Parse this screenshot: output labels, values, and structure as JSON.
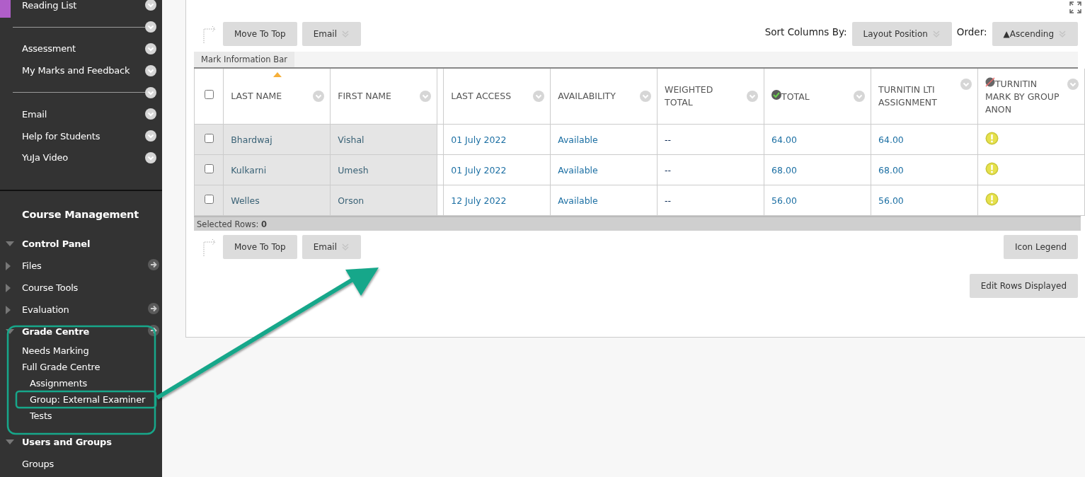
{
  "sidebar": {
    "course_menu": [
      {
        "kind": "link",
        "label": "Reading List"
      },
      {
        "kind": "divider"
      },
      {
        "kind": "link",
        "label": "Assessment"
      },
      {
        "kind": "link",
        "label": "My Marks and Feedback"
      },
      {
        "kind": "divider"
      },
      {
        "kind": "link",
        "label": "Email"
      },
      {
        "kind": "link",
        "label": "Help for Students"
      },
      {
        "kind": "link",
        "label": "YuJa Video"
      }
    ],
    "management": {
      "title": "Course Management",
      "sections": [
        {
          "label": "Control Panel",
          "expanded": true,
          "children": [
            {
              "label": "Files",
              "expanded": false,
              "go_icon": true
            },
            {
              "label": "Course Tools",
              "expanded": false,
              "go_icon": false
            },
            {
              "label": "Evaluation",
              "expanded": false,
              "go_icon": true
            },
            {
              "label": "Grade Centre",
              "expanded": true,
              "go_icon": true,
              "children": [
                {
                  "label": "Needs Marking"
                },
                {
                  "label": "Full Grade Centre",
                  "children": [
                    {
                      "label": "Assignments"
                    },
                    {
                      "label": "Group: External Examiner"
                    },
                    {
                      "label": "Tests"
                    }
                  ]
                }
              ]
            }
          ]
        },
        {
          "label": "Users and Groups",
          "expanded": true,
          "children": [
            {
              "label": "Groups"
            }
          ]
        }
      ]
    }
  },
  "grade_centre": {
    "top_actions": [
      {
        "label": "Move To Top",
        "menu": false
      },
      {
        "label": "Email",
        "menu": true
      }
    ],
    "sort_columns": {
      "label": "Sort Columns By:",
      "value": "Layout Position"
    },
    "order": {
      "label": "Order:",
      "value": "▲Ascending"
    },
    "mark_information_bar": "Mark Information Bar",
    "table": {
      "columns": [
        {
          "label": "LAST NAME",
          "sorted": true,
          "frozen": true,
          "kind": "name"
        },
        {
          "label": "FIRST NAME",
          "sorted": false,
          "frozen": true,
          "kind": "name"
        },
        {
          "label": "LAST ACCESS",
          "sorted": false,
          "frozen": false,
          "kind": "link"
        },
        {
          "label": "AVAILABILITY",
          "sorted": false,
          "frozen": false,
          "kind": "link"
        },
        {
          "label": "WEIGHTED TOTAL",
          "sorted": false,
          "frozen": false,
          "kind": "grade"
        },
        {
          "label": "TOTAL",
          "sorted": false,
          "frozen": false,
          "kind": "total"
        },
        {
          "label": "TURNITIN LTI ASSIGNMENT",
          "sorted": false,
          "frozen": false,
          "kind": "link"
        },
        {
          "label": "TURNITIN MARK BY GROUP ANON",
          "sorted": false,
          "frozen": false,
          "kind": "status"
        }
      ],
      "select_all_checked": false,
      "rows": [
        {
          "checked": false,
          "cells": [
            "Bhardwaj",
            "Vishal",
            "01 July 2022",
            "Available",
            "--",
            "64.00",
            "64.00"
          ],
          "needs_attention": true
        },
        {
          "checked": false,
          "cells": [
            "Kulkarni",
            "Umesh",
            "01 July 2022",
            "Available",
            "--",
            "68.00",
            "68.00"
          ],
          "needs_attention": true
        },
        {
          "checked": false,
          "cells": [
            "Welles",
            "Orson",
            "12 July 2022",
            "Available",
            "--",
            "56.00",
            "56.00"
          ],
          "needs_attention": true
        }
      ]
    },
    "selected_rows": "Selected Rows: **0**",
    "bottom_actions": [
      {
        "label": "Move To Top",
        "menu": false
      },
      {
        "label": "Email",
        "menu": true
      }
    ],
    "icon_legend": "Icon Legend",
    "edit_rows": "Edit Rows Displayed"
  }
}
